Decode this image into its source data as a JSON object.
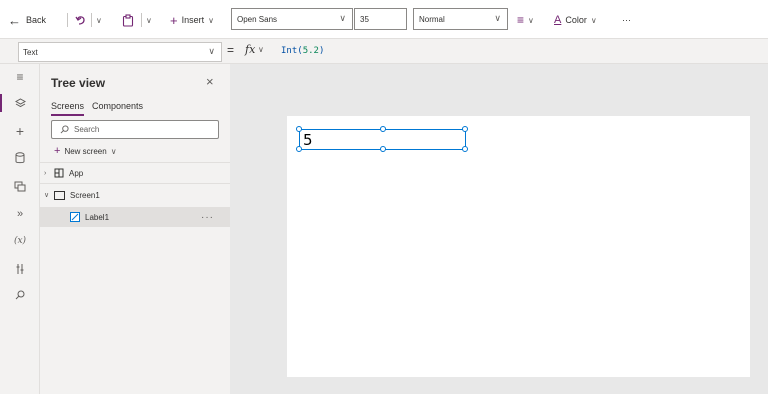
{
  "toolbar": {
    "back_label": "Back",
    "insert_label": "Insert",
    "font_family": "Open Sans",
    "font_size": "35",
    "font_weight": "Normal",
    "color_label": "Color",
    "more_label": "···"
  },
  "formula_bar": {
    "property": "Text",
    "equals": "=",
    "fx": "fx",
    "formula_fn": "Int(",
    "formula_arg": "5.2",
    "formula_close": ")"
  },
  "tree_view": {
    "title": "Tree view",
    "close": "×",
    "tabs": [
      "Screens",
      "Components"
    ],
    "search_placeholder": "Search",
    "new_screen_label": "New screen",
    "items": [
      {
        "label": "App"
      },
      {
        "label": "Screen1"
      },
      {
        "label": "Label1"
      }
    ],
    "more": "···"
  },
  "canvas": {
    "label_text": "5"
  },
  "colors": {
    "accent": "#742774",
    "selection": "#0078d4",
    "canvas_bg": "#e8e8e8",
    "pane_bg": "#f3f2f1"
  }
}
